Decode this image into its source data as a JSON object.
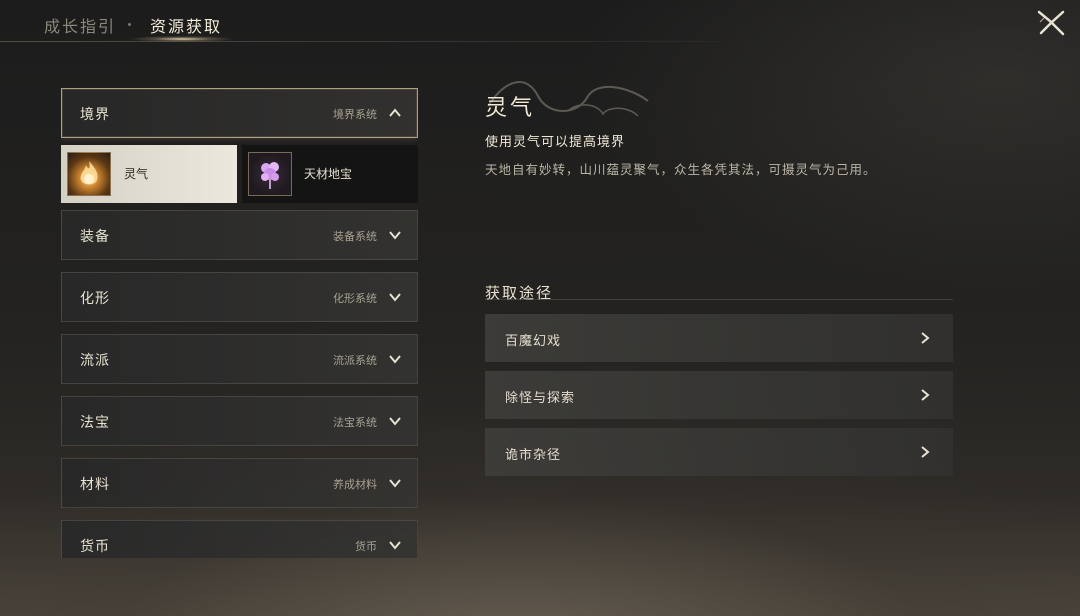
{
  "tabs": {
    "growth": "成长指引",
    "resource": "资源获取"
  },
  "categories": [
    {
      "name": "境界",
      "sub": "境界系统",
      "state": "expanded"
    },
    {
      "name": "装备",
      "sub": "装备系统",
      "state": "collapsed"
    },
    {
      "name": "化形",
      "sub": "化形系统",
      "state": "collapsed"
    },
    {
      "name": "流派",
      "sub": "流派系统",
      "state": "collapsed"
    },
    {
      "name": "法宝",
      "sub": "法宝系统",
      "state": "collapsed"
    },
    {
      "name": "材料",
      "sub": "养成材料",
      "state": "collapsed"
    },
    {
      "name": "货币",
      "sub": "货币",
      "state": "collapsed"
    }
  ],
  "items": [
    {
      "label": "灵气",
      "icon": "flame-icon",
      "selected": true
    },
    {
      "label": "天材地宝",
      "icon": "purple-herb-icon",
      "selected": false
    }
  ],
  "detail": {
    "title": "灵气",
    "subtitle": "使用灵气可以提高境界",
    "description": "天地自有妙转，山川蕴灵聚气，众生各凭其法，可摄灵气为己用。"
  },
  "sources": {
    "heading": "获取途径",
    "items": [
      "百魔幻戏",
      "除怪与探索",
      "诡市杂径"
    ]
  },
  "colors": {
    "accent": "#f1ead8",
    "selected_item_bg": "#e6e1d6",
    "panel_bg": "#2c2b29"
  }
}
